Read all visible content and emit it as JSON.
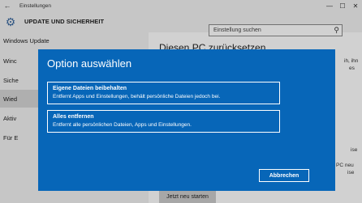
{
  "window": {
    "back_glyph": "←",
    "title": "Einstellungen",
    "minimize_glyph": "—",
    "maximize_glyph": "☐",
    "close_glyph": "✕"
  },
  "header": {
    "icon": "gear-icon",
    "title": "UPDATE UND SICHERHEIT",
    "search_placeholder": "Einstellung suchen",
    "search_icon": "search-icon"
  },
  "sidebar": {
    "items": [
      {
        "label": "Windows Update"
      },
      {
        "label": "Winc"
      },
      {
        "label": "Siche"
      },
      {
        "label": "Wied"
      },
      {
        "label": "Aktiv"
      },
      {
        "label": "Für E"
      }
    ],
    "selected_index": 3
  },
  "main": {
    "title": "Diesen PC zurücksetzen",
    "fragments": [
      "ih, ihn",
      "es",
      "ise",
      "PC neu",
      "ise"
    ],
    "restart_button": "Jetzt neu starten"
  },
  "dialog": {
    "title": "Option auswählen",
    "options": [
      {
        "title": "Eigene Dateien beibehalten",
        "description": "Entfernt Apps und Einstellungen, behält persönliche Dateien jedoch bei."
      },
      {
        "title": "Alles entfernen",
        "description": "Entfernt alle persönlichen Dateien, Apps und Einstellungen."
      }
    ],
    "cancel_button": "Abbrechen"
  },
  "colors": {
    "dialog_bg": "#0766b8",
    "chrome_bg": "#f2f2f2",
    "selected_bg": "#d6d6d6"
  }
}
